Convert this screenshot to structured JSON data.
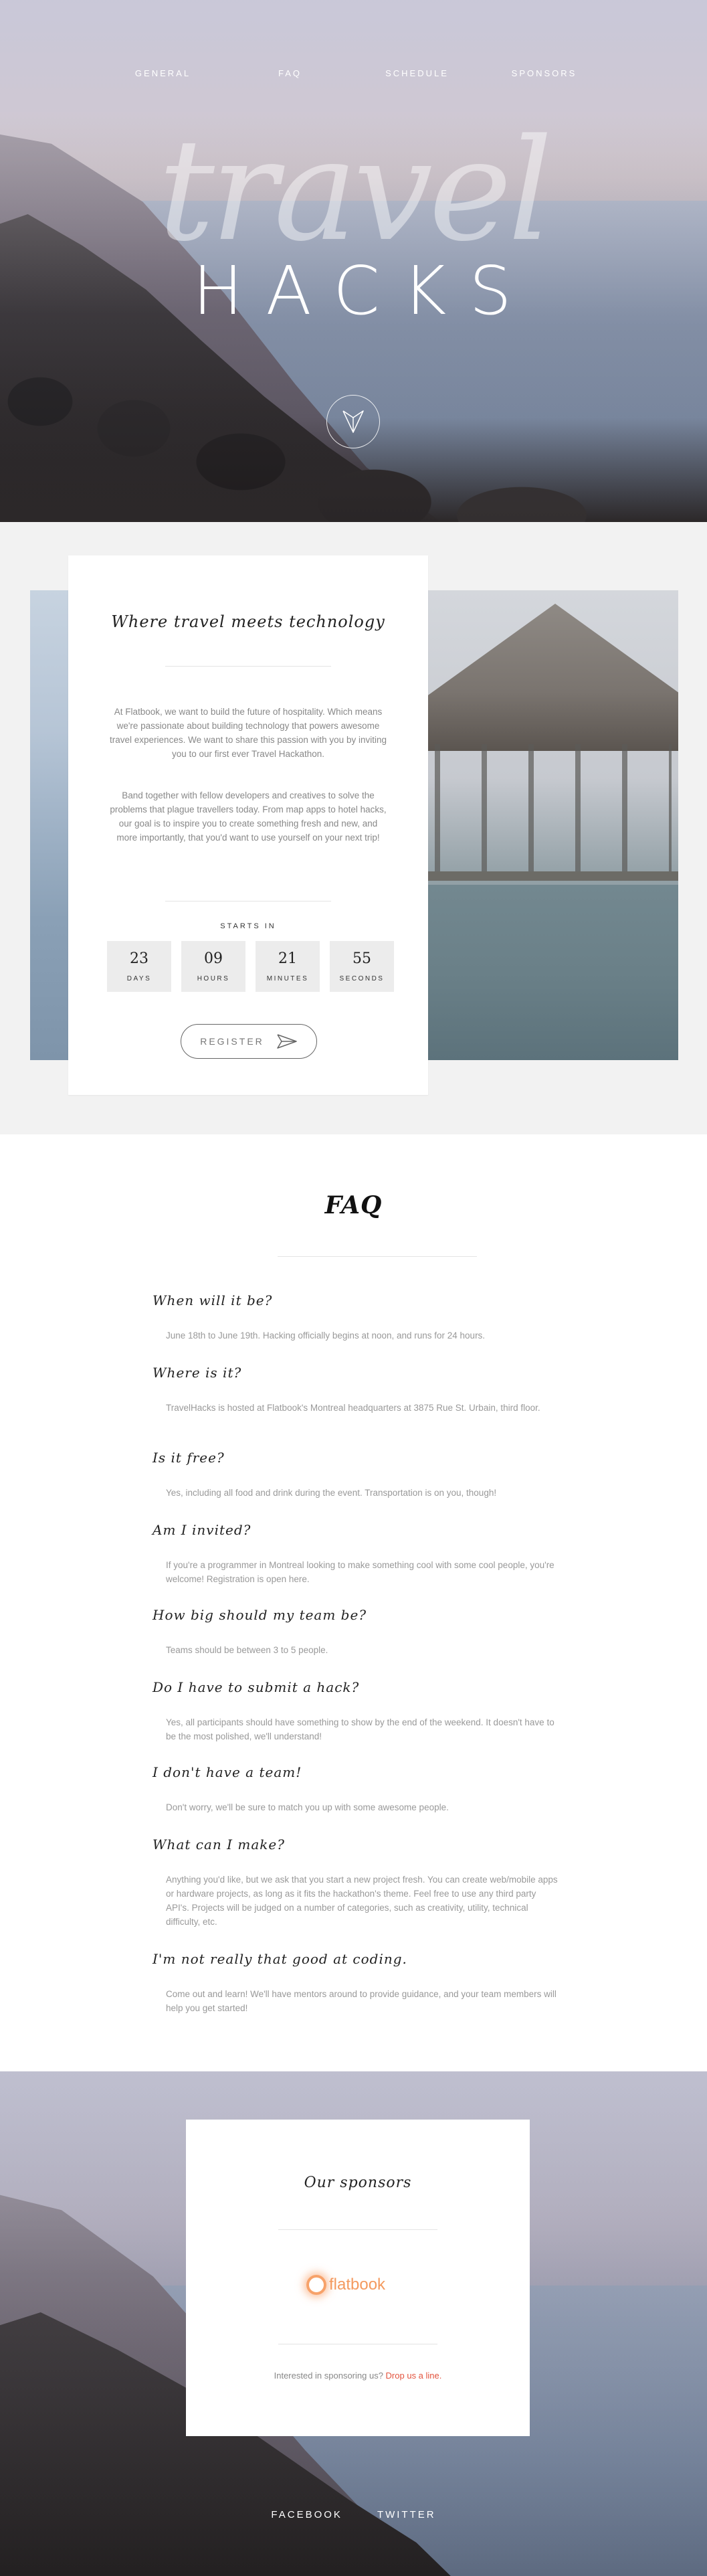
{
  "nav": {
    "items": [
      {
        "label": "GENERAL"
      },
      {
        "label": "FAQ"
      },
      {
        "label": "SCHEDULE"
      },
      {
        "label": "SPONSORS"
      }
    ]
  },
  "hero": {
    "logo_script": "travel",
    "logo_caps": "HACKS",
    "scroll_icon": "paper-plane-icon"
  },
  "intro": {
    "title": "Where travel meets technology",
    "paragraphs": [
      "At Flatbook, we want to build the future of hospitality. Which means we're passionate about building technology that powers awesome travel experiences. We want to share this passion with you by inviting you to our first ever Travel Hackathon.",
      "Band together with fellow developers and creatives to solve the problems that plague travellers today. From map apps to hotel hacks, our goal is to inspire you to create something fresh and new, and more importantly, that you'd want to use yourself on your next trip!"
    ],
    "starts_label": "STARTS IN",
    "countdown": [
      {
        "value": "23",
        "label": "DAYS"
      },
      {
        "value": "09",
        "label": "HOURS"
      },
      {
        "value": "21",
        "label": "MINUTES"
      },
      {
        "value": "55",
        "label": "SECONDS"
      }
    ],
    "register_label": "REGISTER",
    "register_icon": "paper-plane-icon"
  },
  "faq": {
    "title": "FAQ",
    "items": [
      {
        "q": "When will it be?",
        "a": "June 18th to June 19th. Hacking officially begins at noon, and runs for 24 hours."
      },
      {
        "q": "Where is it?",
        "a": "TravelHacks is hosted at Flatbook's Montreal headquarters at 3875 Rue St. Urbain, third floor."
      },
      {
        "q": "Is it free?",
        "a": "Yes, including all food and drink during the event. Transportation is on you, though!"
      },
      {
        "q": "Am I invited?",
        "a": "If you're a programmer in Montreal looking to make something cool with some cool people, you're welcome! Registration is open here."
      },
      {
        "q": "How big should my team be?",
        "a": "Teams should be between 3 to 5 people."
      },
      {
        "q": "Do I have to submit a hack?",
        "a": "Yes, all participants should have something to show by the end of the weekend. It doesn't have to be the most polished, we'll understand!"
      },
      {
        "q": "I don't have a team!",
        "a": "Don't worry, we'll be sure to match you up with some awesome people."
      },
      {
        "q": "What can I make?",
        "a": "Anything you'd like, but we ask that you start a new project fresh. You can create web/mobile apps or hardware projects, as long as it fits the hackathon's theme. Feel free to use any third party API's. Projects will be judged on a number of categories, such as creativity, utility, technical difficulty, etc."
      },
      {
        "q": "I'm not really that good at coding.",
        "a": "Come out and learn! We'll have mentors around to provide guidance, and your team members will help you get started!"
      }
    ]
  },
  "sponsors": {
    "title": "Our sponsors",
    "logo_text": "flatbook",
    "note_text": "Interested in sponsoring us? ",
    "note_link": "Drop us a line."
  },
  "footer": {
    "links": [
      {
        "label": "FACEBOOK"
      },
      {
        "label": "TWITTER"
      }
    ]
  },
  "colors": {
    "accent_link": "#e3543e",
    "flatbook_orange": "#f49a5f"
  }
}
